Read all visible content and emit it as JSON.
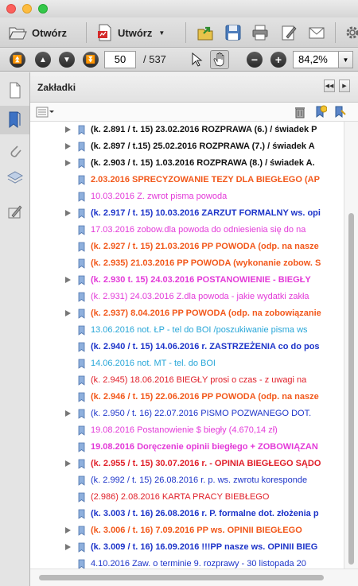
{
  "toolbar": {
    "open_label": "Otwórz",
    "create_label": "Utwórz",
    "create_dropdown_arrow": "▼"
  },
  "nav": {
    "current_page": "50",
    "total_pages": "/ 537",
    "zoom": "84,2%"
  },
  "panel": {
    "title": "Zakładki"
  },
  "colors": {
    "black": "#111111",
    "orange": "#f2581b",
    "magenta": "#e33ad8",
    "blue": "#1d34c9",
    "cyan": "#27a6d8",
    "red": "#e0202a"
  },
  "bookmarks": [
    {
      "text": "(k. 2.891 / t. 15) 23.02.2016 ROZPRAWA (6.) / świadek P",
      "color": "black",
      "bold": true,
      "arrow": true
    },
    {
      "text": "(k. 2.897 / t.15) 25.02.2016 ROZPRAWA (7.) / świadek A",
      "color": "black",
      "bold": true,
      "arrow": true
    },
    {
      "text": "(k. 2.903 / t. 15) 1.03.2016 ROZPRAWA (8.) / świadek A.",
      "color": "black",
      "bold": true,
      "arrow": true
    },
    {
      "text": "2.03.2016 SPRECYZOWANIE TEZY DLA BIEGŁEGO (AP",
      "color": "orange",
      "bold": true,
      "arrow": false
    },
    {
      "text": "10.03.2016 Z. zwrot pisma powoda",
      "color": "magenta",
      "bold": false,
      "arrow": false
    },
    {
      "text": "(k. 2.917 / t. 15) 10.03.2016 ZARZUT FORMALNY ws. opi",
      "color": "blue",
      "bold": true,
      "arrow": true
    },
    {
      "text": "17.03.2016 zobow.dla powoda do odniesienia się do na",
      "color": "magenta",
      "bold": false,
      "arrow": false
    },
    {
      "text": "(k. 2.927 / t. 15)  21.03.2016 PP POWODA (odp. na nasze",
      "color": "orange",
      "bold": true,
      "arrow": false
    },
    {
      "text": "(k. 2.935) 21.03.2016 PP POWODA (wykonanie zobow. S",
      "color": "orange",
      "bold": true,
      "arrow": false
    },
    {
      "text": "(k. 2.930 t. 15) 24.03.2016 POSTANOWIENIE - BIEGŁY",
      "color": "magenta",
      "bold": true,
      "arrow": true
    },
    {
      "text": "(k. 2.931) 24.03.2016 Z.dla powoda - jakie wydatki zakła",
      "color": "magenta",
      "bold": false,
      "arrow": false
    },
    {
      "text": "(k. 2.937) 8.04.2016 PP POWODA (odp. na zobowiązanie",
      "color": "orange",
      "bold": true,
      "arrow": true
    },
    {
      "text": "13.06.2016 not. ŁP - tel do BOI /poszukiwanie pisma ws",
      "color": "cyan",
      "bold": false,
      "arrow": false
    },
    {
      "text": "(k. 2.940 / t. 15) 14.06.2016 r. ZASTRZEŻENIA co do pos",
      "color": "blue",
      "bold": true,
      "arrow": false
    },
    {
      "text": "14.06.2016 not. MT - tel. do BOI",
      "color": "cyan",
      "bold": false,
      "arrow": false
    },
    {
      "text": "(k. 2.945) 18.06.2016 BIEGŁY prosi o czas - z uwagi na",
      "color": "red",
      "bold": false,
      "arrow": false
    },
    {
      "text": "(k. 2.946 / t. 15) 22.06.2016 PP POWODA (odp. na nasze",
      "color": "orange",
      "bold": true,
      "arrow": false
    },
    {
      "text": "(k. 2.950 / t. 16) 22.07.2016 PISMO POZWANEGO DOT.",
      "color": "blue",
      "bold": false,
      "arrow": true
    },
    {
      "text": "19.08.2016 Postanowienie $ biegły (4.670,14 zł)",
      "color": "magenta",
      "bold": false,
      "arrow": false
    },
    {
      "text": "19.08.2016 Doręczenie opinii biegłego + ZOBOWIĄZAN",
      "color": "magenta",
      "bold": true,
      "arrow": false
    },
    {
      "text": "(k. 2.955 / t. 15) 30.07.2016 r. - OPINIA BIEGŁEGO SĄDO",
      "color": "red",
      "bold": true,
      "arrow": true
    },
    {
      "text": "(k. 2.992 / t. 15) 26.08.2016 r. p. ws. zwrotu koresponde",
      "color": "blue",
      "bold": false,
      "arrow": false
    },
    {
      "text": "(2.986) 2.08.2016 KARTA PRACY BIEBŁEGO",
      "color": "red",
      "bold": false,
      "arrow": false
    },
    {
      "text": "(k. 3.003 / t. 16) 26.08.2016 r. P. formalne dot. złożenia p",
      "color": "blue",
      "bold": true,
      "arrow": false
    },
    {
      "text": "(k. 3.006 / t. 16) 7.09.2016 PP ws. OPINII BIEGŁEGO",
      "color": "orange",
      "bold": true,
      "arrow": true
    },
    {
      "text": "(k. 3.009 / t. 16) 16.09.2016 !!!PP nasze ws. OPINII BIEG",
      "color": "blue",
      "bold": true,
      "arrow": true
    },
    {
      "text": "4.10.2016 Zaw. o terminie 9. rozprawy - 30 listopada 20",
      "color": "blue",
      "bold": false,
      "arrow": false
    }
  ]
}
